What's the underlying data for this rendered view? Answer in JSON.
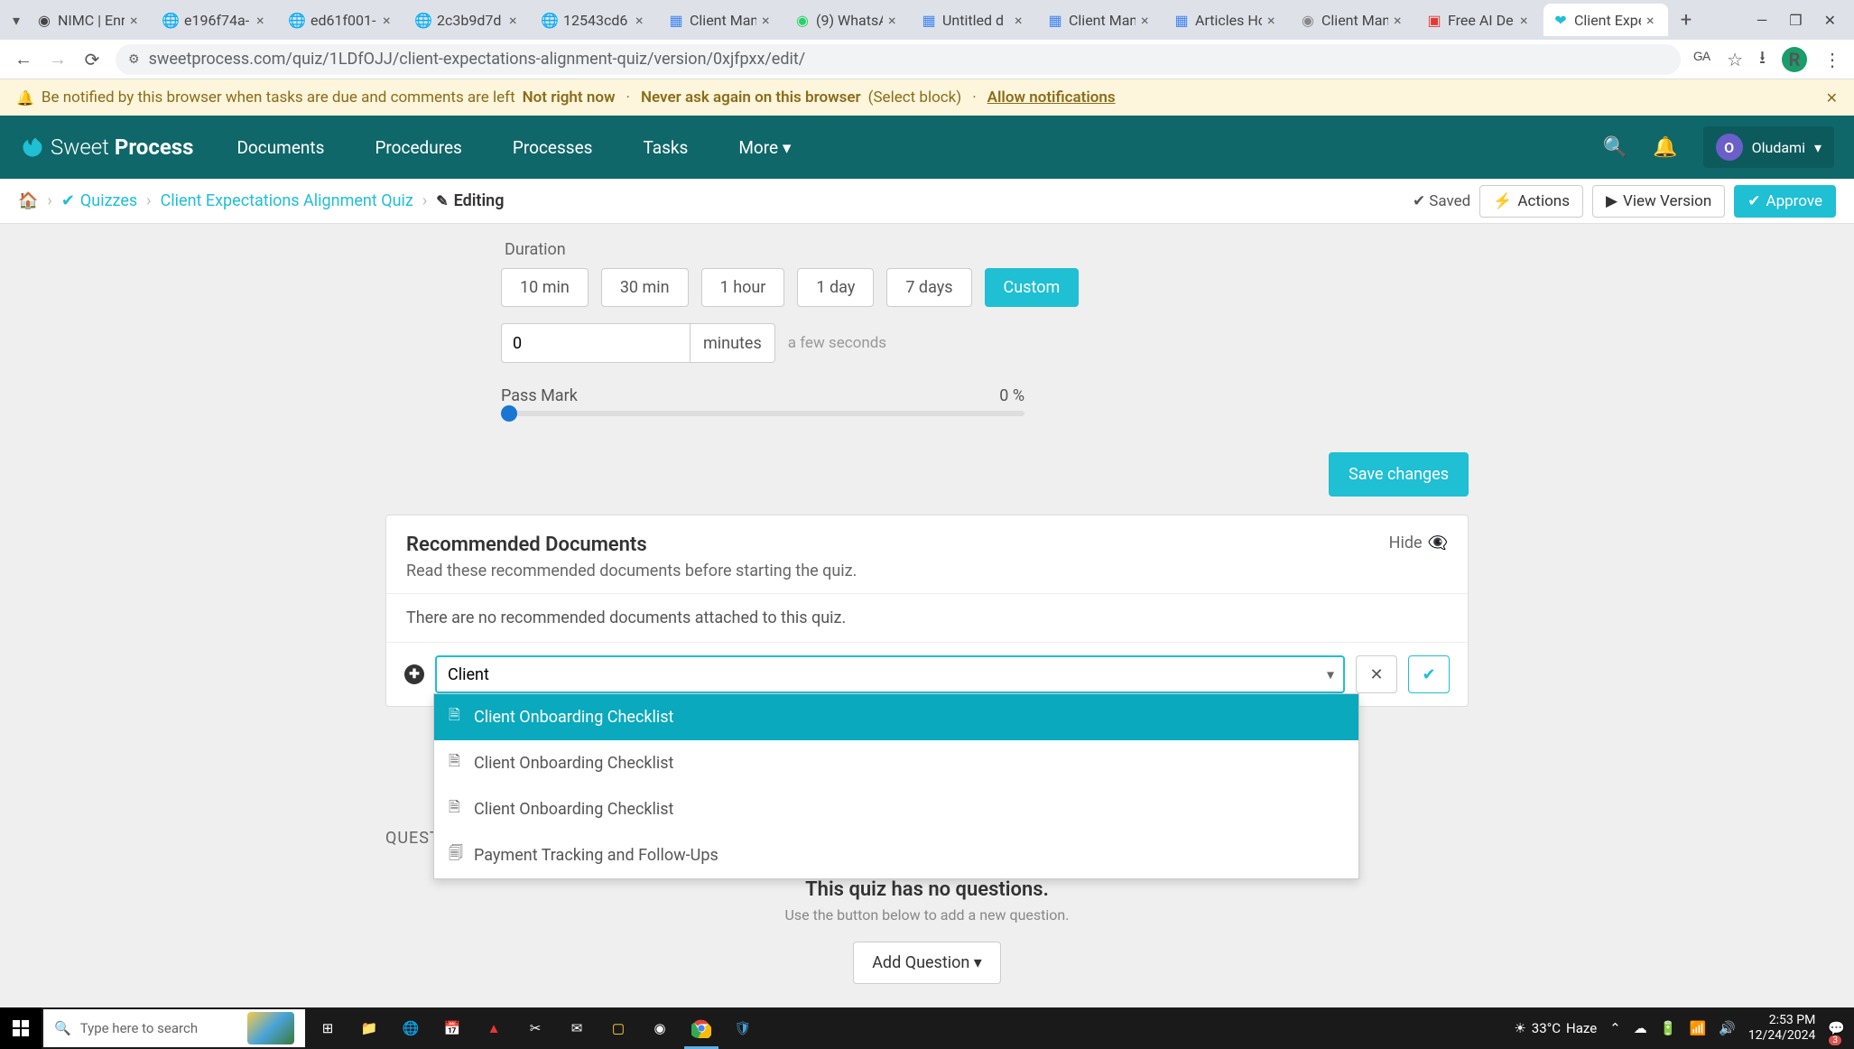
{
  "browser": {
    "tabs": [
      {
        "title": "NIMC | Enr",
        "icon": "circle"
      },
      {
        "title": "e196f74a-",
        "icon": "globe"
      },
      {
        "title": "ed61f001-",
        "icon": "globe"
      },
      {
        "title": "2c3b9d7d",
        "icon": "globe"
      },
      {
        "title": "12543cd6",
        "icon": "globe"
      },
      {
        "title": "Client Man",
        "icon": "gdoc"
      },
      {
        "title": "(9) WhatsA",
        "icon": "whatsapp"
      },
      {
        "title": "Untitled d",
        "icon": "gdoc"
      },
      {
        "title": "Client Man",
        "icon": "gdoc"
      },
      {
        "title": "Articles Ho",
        "icon": "gdoc"
      },
      {
        "title": "Client Man",
        "icon": "circle-grey"
      },
      {
        "title": "Free AI De",
        "icon": "red"
      },
      {
        "title": "Client Expe",
        "icon": "sp",
        "active": true
      }
    ],
    "url": "sweetprocess.com/quiz/1LDfOJJ/client-expectations-alignment-quiz/version/0xjfpxx/edit/",
    "avatar_letter": "R"
  },
  "notif": {
    "text": "Be notified by this browser when tasks are due and comments are left",
    "not_now": "Not right now",
    "never": "Never ask again on this browser",
    "select_block": "(Select block)",
    "allow": "Allow notifications"
  },
  "nav": {
    "logo_thin": "Sweet",
    "logo_bold": "Process",
    "links": [
      "Documents",
      "Procedures",
      "Processes",
      "Tasks",
      "More"
    ],
    "user_letter": "O",
    "user_name": "Oludami"
  },
  "crumbs": {
    "quizzes": "Quizzes",
    "quiz_name": "Client Expectations Alignment Quiz",
    "editing": "Editing",
    "saved": "Saved",
    "actions": "Actions",
    "view_version": "View Version",
    "approve": "Approve"
  },
  "form": {
    "duration_label": "Duration",
    "duration_opts": [
      "10 min",
      "30 min",
      "1 hour",
      "1 day",
      "7 days",
      "Custom"
    ],
    "minutes_value": "0",
    "minutes_label": "minutes",
    "minutes_hint": "a few seconds",
    "passmark_label": "Pass Mark",
    "passmark_value": "0 %",
    "save_changes": "Save changes"
  },
  "recdocs": {
    "title": "Recommended Documents",
    "subtitle": "Read these recommended documents before starting the quiz.",
    "hide": "Hide",
    "empty": "There are no recommended documents attached to this quiz.",
    "search_value": "Client",
    "dropdown": [
      {
        "label": "Client Onboarding Checklist",
        "selected": true
      },
      {
        "label": "Client Onboarding Checklist",
        "selected": false
      },
      {
        "label": "Client Onboarding Checklist",
        "selected": false
      },
      {
        "label": "Payment Tracking and Follow-Ups",
        "selected": false,
        "multi": true
      }
    ]
  },
  "questions": {
    "header": "QUEST",
    "empty_title": "This quiz has no questions.",
    "empty_sub": "Use the button below to add a new question.",
    "add_btn": "Add Question"
  },
  "taskbar": {
    "search_placeholder": "Type here to search",
    "weather_temp": "33°C",
    "weather_text": "Haze",
    "time": "2:53 PM",
    "date": "12/24/2024",
    "notif_count": "3"
  }
}
